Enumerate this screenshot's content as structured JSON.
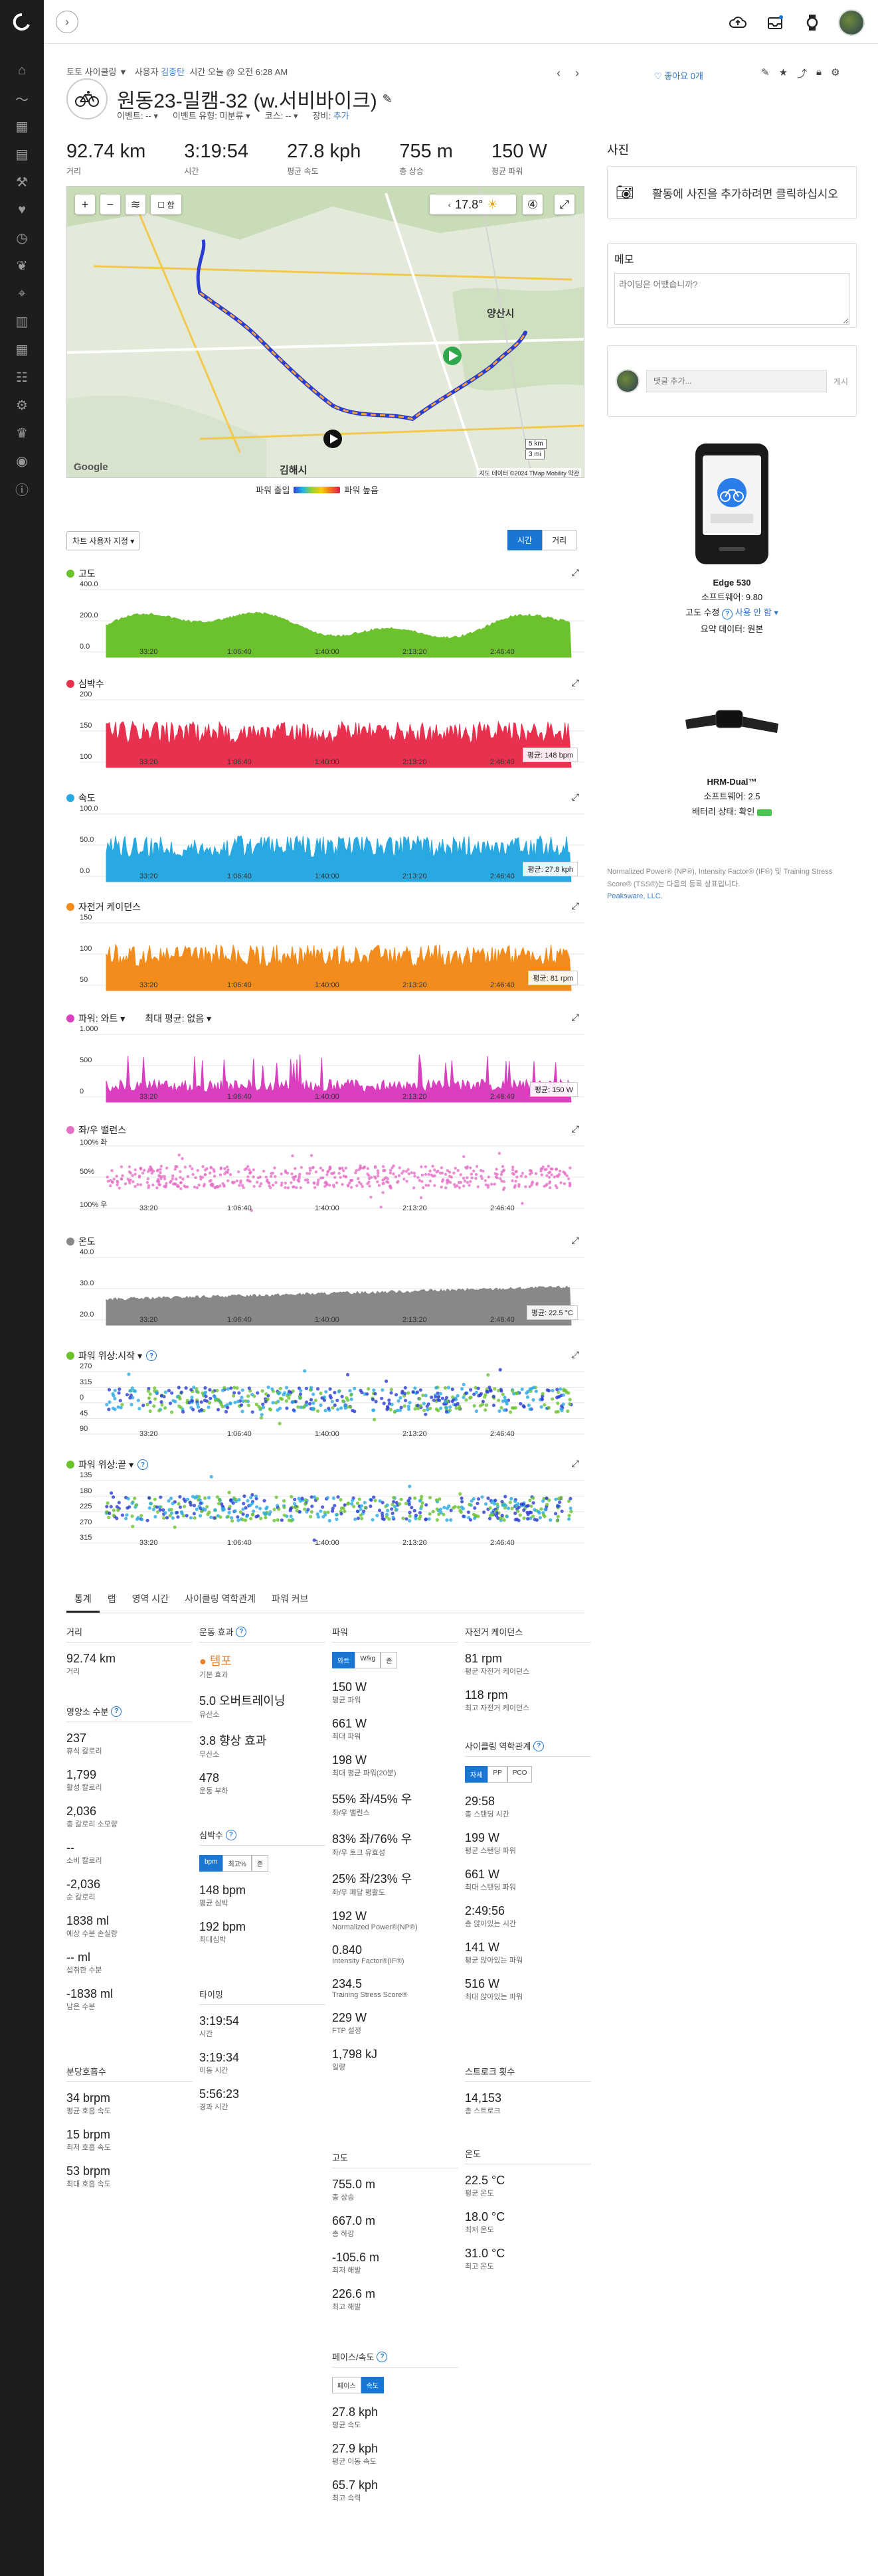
{
  "nav": {
    "expand_glyph": "›"
  },
  "breadcrumb": {
    "prefix": "토토 사이클링 ▼",
    "by": "사용자",
    "user": "김종탄",
    "time": "시간 오늘 @ 오전 6:28 AM"
  },
  "activity": {
    "title": "원동23-밀캠-32 (w.서비바이크)",
    "event_label": "이벤트:",
    "event_value": "-- ▾",
    "event_type_label": "이벤트 유형:",
    "event_type_value": "미분류 ▾",
    "course_label": "코스:",
    "course_value": "-- ▾",
    "gear_label": "장비:",
    "gear_value": "추가"
  },
  "summary": [
    {
      "value": "92.74 km",
      "label": "거리"
    },
    {
      "value": "3:19:54",
      "label": "시간"
    },
    {
      "value": "27.8 kph",
      "label": "평균 속도"
    },
    {
      "value": "755 m",
      "label": "총 상승"
    },
    {
      "value": "150 W",
      "label": "평균 파워"
    }
  ],
  "header_actions": {
    "like": "좋아요 0개"
  },
  "map": {
    "temp": "17.8°",
    "city1": "양산시",
    "city2": "김해시",
    "scale_km": "5 km",
    "scale_mi": "3 mi",
    "attribution": "지도 데이터 ©2024 TMap Mobility   약관",
    "google": "Google"
  },
  "power_legend": {
    "low": "파워 출입",
    "high": "파워 높음"
  },
  "chart_controls": {
    "dropdown": "차트 사용자 지정 ▾",
    "time": "시간",
    "distance": "거리"
  },
  "x_ticks": [
    "33:20",
    "1:06:40",
    "1:40:00",
    "2:13:20",
    "2:46:40"
  ],
  "charts": [
    {
      "title": "고도",
      "color": "#6cc22d",
      "y": [
        "400.0",
        "200.0",
        "0.0"
      ],
      "avg": ""
    },
    {
      "title": "심박수",
      "color": "#e8304f",
      "y": [
        "200",
        "150",
        "100"
      ],
      "avg": "평균: 148 bpm"
    },
    {
      "title": "속도",
      "color": "#29a9e1",
      "y": [
        "100.0",
        "50.0",
        "0.0"
      ],
      "avg": "평균: 27.8 kph"
    },
    {
      "title": "자전거 케이던스",
      "color": "#f28c1c",
      "y": [
        "150",
        "100",
        "50"
      ],
      "avg": "평균: 81 rpm"
    },
    {
      "title": "파워: 와트 ▾",
      "color": "#d93fbf",
      "y": [
        "1.000",
        "500",
        "0"
      ],
      "avg": "평균: 150 W",
      "extra": "최대 평균: 없음 ▾"
    },
    {
      "title": "좌/우 밸런스",
      "color": "#e571c7",
      "y": [
        "100% 좌",
        "50%",
        "100% 우"
      ],
      "avg": ""
    },
    {
      "title": "온도",
      "color": "#888888",
      "y": [
        "40.0",
        "30.0",
        "20.0"
      ],
      "avg": "평균: 22.5 °C"
    },
    {
      "title": "파워 위상:시작 ▾",
      "color": "#6cc22d",
      "y": [
        "270",
        "315",
        "0",
        "45",
        "90"
      ],
      "avg": ""
    },
    {
      "title": "파워 위상:끝 ▾",
      "color": "#6cc22d",
      "y": [
        "135",
        "180",
        "225",
        "270",
        "315"
      ],
      "avg": ""
    }
  ],
  "tabs": [
    "통계",
    "랩",
    "영역 시간",
    "사이클링 역학관계",
    "파워 커브"
  ],
  "stats": {
    "distance": {
      "head": "거리",
      "items": [
        {
          "v": "92.74 km",
          "l": "거리"
        }
      ]
    },
    "nutrition": {
      "head": "영양소 수분",
      "items": [
        {
          "v": "237",
          "l": "휴식 칼로리"
        },
        {
          "v": "1,799",
          "l": "활성 칼로리"
        },
        {
          "v": "2,036",
          "l": "총 칼로리 소모량"
        },
        {
          "v": "--",
          "l": "소비 칼로리"
        },
        {
          "v": "-2,036",
          "l": "순 칼로리"
        },
        {
          "v": "1838 ml",
          "l": "예상 수분 손실량"
        },
        {
          "v": "-- ml",
          "l": "섭취한 수분"
        },
        {
          "v": "-1838 ml",
          "l": "남은 수분"
        }
      ]
    },
    "breathing": {
      "head": "분당호흡수",
      "items": [
        {
          "v": "34 brpm",
          "l": "평균 호흡 속도"
        },
        {
          "v": "15 brpm",
          "l": "최저 호흡 속도"
        },
        {
          "v": "53 brpm",
          "l": "최대 호흡 속도"
        }
      ]
    },
    "training": {
      "head": "운동 효과",
      "items": [
        {
          "v": "● 템포",
          "l": "기본 효과"
        },
        {
          "v": "5.0 오버트레이닝",
          "l": "유산소"
        },
        {
          "v": "3.8 향상 효과",
          "l": "무산소"
        },
        {
          "v": "478",
          "l": "운동 부하"
        }
      ]
    },
    "hr": {
      "head": "심박수",
      "tabs": [
        "bpm",
        "최고%",
        "존"
      ],
      "items": [
        {
          "v": "148 bpm",
          "l": "평균 심박"
        },
        {
          "v": "192 bpm",
          "l": "최대심박"
        }
      ]
    },
    "timing": {
      "head": "타이밍",
      "items": [
        {
          "v": "3:19:54",
          "l": "시간"
        },
        {
          "v": "3:19:34",
          "l": "이동 시간"
        },
        {
          "v": "5:56:23",
          "l": "경과 시간"
        }
      ]
    },
    "power": {
      "head": "파워",
      "tabs": [
        "와트",
        "W/kg",
        "존"
      ],
      "items": [
        {
          "v": "150 W",
          "l": "평균 파워"
        },
        {
          "v": "661 W",
          "l": "최대 파워"
        },
        {
          "v": "198 W",
          "l": "최대 평균 파워(20분)"
        },
        {
          "v": "55% 좌/45% 우",
          "l": "좌/우 밸런스"
        },
        {
          "v": "83% 좌/76% 우",
          "l": "좌/우 토크 유효성"
        },
        {
          "v": "25% 좌/23% 우",
          "l": "좌/우 페달 평활도"
        },
        {
          "v": "192 W",
          "l": "Normalized Power®(NP®)"
        },
        {
          "v": "0.840",
          "l": "Intensity Factor®(IF®)"
        },
        {
          "v": "234.5",
          "l": "Training Stress Score®"
        },
        {
          "v": "229 W",
          "l": "FTP 설정"
        },
        {
          "v": "1,798 kJ",
          "l": "일량"
        }
      ]
    },
    "elevation": {
      "head": "고도",
      "items": [
        {
          "v": "755.0 m",
          "l": "총 상승"
        },
        {
          "v": "667.0 m",
          "l": "총 하강"
        },
        {
          "v": "-105.6 m",
          "l": "최저 해발"
        },
        {
          "v": "226.6 m",
          "l": "최고 해발"
        }
      ]
    },
    "pace": {
      "head": "페이스/속도",
      "tabs": [
        "페이스",
        "속도"
      ],
      "items": [
        {
          "v": "27.8 kph",
          "l": "평균 속도"
        },
        {
          "v": "27.9 kph",
          "l": "평균 이동 속도"
        },
        {
          "v": "65.7 kph",
          "l": "최고 속력"
        }
      ]
    },
    "cadence": {
      "head": "자전거 케이던스",
      "items": [
        {
          "v": "81 rpm",
          "l": "평균 자전거 케이던스"
        },
        {
          "v": "118 rpm",
          "l": "최고 자전거 케이던스"
        }
      ]
    },
    "dynamics": {
      "head": "사이클링 역학관계",
      "tabs": [
        "자세",
        "PP",
        "PCO"
      ],
      "items": [
        {
          "v": "29:58",
          "l": "총 스탠딩 시간"
        },
        {
          "v": "199 W",
          "l": "평균 스탠딩 파워"
        },
        {
          "v": "661 W",
          "l": "최대 스탠딩 파워"
        },
        {
          "v": "2:49:56",
          "l": "총 앉아있는 시간"
        },
        {
          "v": "141 W",
          "l": "평균 앉아있는 파워"
        },
        {
          "v": "516 W",
          "l": "최대 앉아있는 파워"
        }
      ]
    },
    "strokes": {
      "head": "스트로크 횟수",
      "items": [
        {
          "v": "14,153",
          "l": "총 스트로크"
        }
      ]
    },
    "temperature": {
      "head": "온도",
      "items": [
        {
          "v": "22.5 °C",
          "l": "평균 온도"
        },
        {
          "v": "18.0 °C",
          "l": "최저 온도"
        },
        {
          "v": "31.0 °C",
          "l": "최고 온도"
        }
      ]
    }
  },
  "right": {
    "photos_title": "사진",
    "photos_cta": "활동에 사진을 추가하려면 클릭하십시오",
    "notes_title": "메모",
    "notes_placeholder": "라이딩은 어땠습니까?",
    "comment_placeholder": "댓글 추가...",
    "comment_post": "게시",
    "device1": {
      "name": "Edge 530",
      "sw": "소프트웨어: 9.80",
      "elev": "고도 수정",
      "elev_v": "사용 안 함 ▾",
      "summary": "요약 데이터: 원본"
    },
    "device2": {
      "name": "HRM-Dual™",
      "sw": "소프트웨어: 2.5",
      "battery": "배터리 상태: 확인"
    },
    "note": "Normalized Power® (NP®), Intensity Factor® (IF®) 및 Training Stress Score® (TSS®)는 다음의 등록 상표입니다.",
    "note_link": "Peaksware, LLC."
  }
}
